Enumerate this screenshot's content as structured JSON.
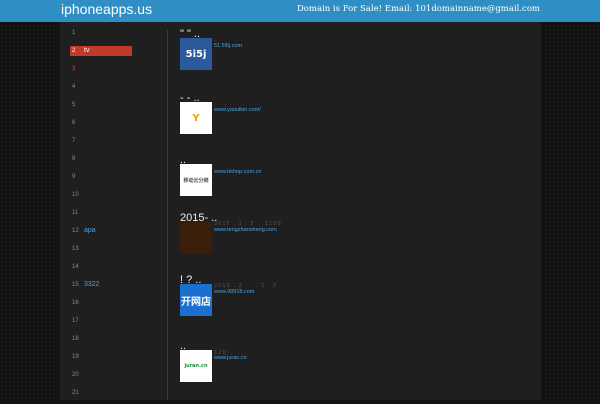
{
  "header": {
    "site_title": "iphoneapps.us",
    "sale_text": "Domain is For Sale! Email: 101domainname@gmail.com"
  },
  "sidebar": {
    "items": [
      {
        "num": "1",
        "label": ""
      },
      {
        "num": "2",
        "label": "tv"
      },
      {
        "num": "3",
        "label": ""
      },
      {
        "num": "4",
        "label": ""
      },
      {
        "num": "5",
        "label": ""
      },
      {
        "num": "6",
        "label": ""
      },
      {
        "num": "7",
        "label": ""
      },
      {
        "num": "8",
        "label": ""
      },
      {
        "num": "9",
        "label": ""
      },
      {
        "num": "10",
        "label": ""
      },
      {
        "num": "11",
        "label": ""
      },
      {
        "num": "12",
        "label": "apa"
      },
      {
        "num": "13",
        "label": ""
      },
      {
        "num": "14",
        "label": ""
      },
      {
        "num": "15",
        "label": "3322"
      },
      {
        "num": "16",
        "label": ""
      },
      {
        "num": "17",
        "label": ""
      },
      {
        "num": "18",
        "label": ""
      },
      {
        "num": "19",
        "label": ""
      },
      {
        "num": "20",
        "label": ""
      },
      {
        "num": "21",
        "label": ""
      }
    ]
  },
  "posts": [
    {
      "title": "\"    \" ..",
      "meta": ",  .",
      "link": "51.5i5j.com",
      "thumb_text": "5i5j",
      "thumb_bg": "#2a5a9c",
      "thumb_fg": "#ffffff"
    },
    {
      "title": "-    -  ..",
      "meta": ",  .  ,  .",
      "link": "www.yaoulkin.com/",
      "thumb_text": "Y",
      "thumb_bg": "#ffffff",
      "thumb_fg": "#f2a100"
    },
    {
      "title": "..",
      "meta": "",
      "link": "www.bkhop.com.cn",
      "thumb_text": "移动云分销",
      "thumb_bg": "#ffffff",
      "thumb_fg": "#555555"
    },
    {
      "title": "2015-      ..",
      "meta": "2015 .  1 .  5  .  .1100",
      "link": "www.tengzhaosheng.com",
      "thumb_text": "",
      "thumb_bg": "#3a1e0a",
      "thumb_fg": "#ff8a00"
    },
    {
      "title": "!   ?    ..",
      "meta": "2015 . 2 .  .   . 3 . 3",
      "link": "www.98918.com",
      "thumb_text": "开网店",
      "thumb_bg": "#1a6fd1",
      "thumb_fg": "#ffffff"
    },
    {
      "title": "..",
      "meta": "12亿 ,  .  ,",
      "link": "www.juran.cn",
      "thumb_text": "juran.cn",
      "thumb_bg": "#ffffff",
      "thumb_fg": "#1b8a3e"
    }
  ]
}
